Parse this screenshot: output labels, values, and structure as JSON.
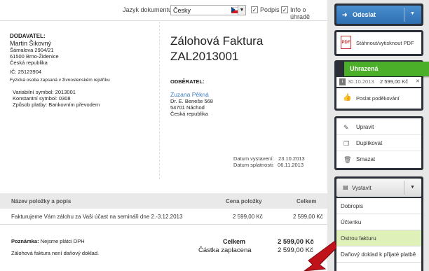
{
  "topbar": {
    "lang_label": "Jazyk dokumentu",
    "lang_value": "Česky",
    "podpis_label": "Podpis",
    "info_label": "Info o úhradě"
  },
  "supplier": {
    "heading": "DODAVATEL:",
    "name": "Martin Šikovný",
    "street": "Šámalova 2904/21",
    "city": "61500 Brno-Židenice",
    "country": "Česká republika",
    "ic": "IČ: 25123904",
    "register_note": "Fyzická osoba zapsaná v živnostenském rejstříku",
    "vs": "Variabilní symbol: 2013001",
    "ks": "Konstantní symbol: 0308",
    "payment": "Způsob platby: Bankovním převodem"
  },
  "invoice": {
    "title": "Zálohová Faktura",
    "number": "ZAL2013001"
  },
  "customer": {
    "heading": "ODBĚRATEL:",
    "name": "Zuzana Pěkná",
    "street": "Dr. E. Beneše 568",
    "city": "54701 Náchod",
    "country": "Česká republika"
  },
  "dates": {
    "issued_label": "Datum vystavení:",
    "issued_value": "23.10.2013",
    "due_label": "Datum splatnosti:",
    "due_value": "06.11.2013"
  },
  "table": {
    "columns": [
      "Název položky a popis",
      "Cena položky",
      "Celkem"
    ],
    "rows": [
      [
        "Fakturujeme Vám zálohu za Vaši účast na semináři dne 2.-3.12.2013",
        "2 599,00 Kč",
        "2 599,00 Kč"
      ]
    ]
  },
  "footer": {
    "note_label": "Poznámka:",
    "note_value": "Nejsme plátci DPH",
    "note_line2": "Zálohová faktura není daňový doklad.",
    "total_label": "Celkem",
    "total_value": "2 599,00 Kč",
    "paid_label": "Částka zaplacena",
    "paid_value": "2 599,00 Kč"
  },
  "sidebar": {
    "send_label": "Odeslat",
    "pdf_label": "Stáhnout/vytisknout PDF",
    "paid_banner": "Uhrazená",
    "paid_date": "30.10.2013",
    "paid_amount": "2 599,00 Kč",
    "thanks_label": "Poslat poděkování",
    "edit_label": "Upravit",
    "duplicate_label": "Duplikovat",
    "delete_label": "Smazat",
    "issue_label": "Vystavit",
    "issue_menu": [
      "Dobropis",
      "Účtenku",
      "Ostrou fakturu",
      "Daňový doklad k přijaté platbě"
    ]
  },
  "colors": {
    "accent_blue": "#2f6fb3",
    "paid_green": "#4caf2a",
    "highlight": "#dff0b8",
    "arrow_red": "#c0121a"
  }
}
